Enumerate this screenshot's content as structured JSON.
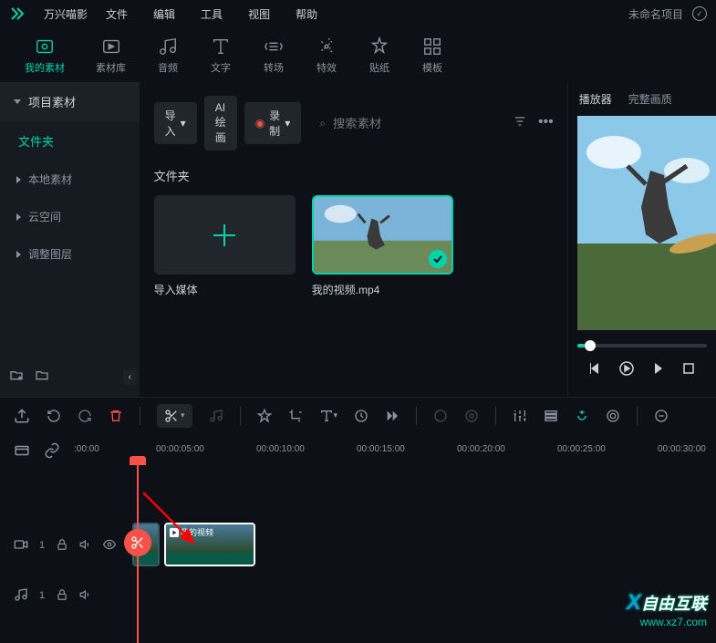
{
  "titlebar": {
    "app_name": "万兴喵影",
    "menus": [
      "文件",
      "编辑",
      "工具",
      "视图",
      "帮助"
    ],
    "project_name": "未命名项目"
  },
  "toolbar_tabs": [
    {
      "label": "我的素材"
    },
    {
      "label": "素材库"
    },
    {
      "label": "音频"
    },
    {
      "label": "文字"
    },
    {
      "label": "转场"
    },
    {
      "label": "特效"
    },
    {
      "label": "贴纸"
    },
    {
      "label": "模板"
    }
  ],
  "sidebar": {
    "header": "项目素材",
    "folder": "文件夹",
    "items": [
      "本地素材",
      "云空间",
      "调整图层"
    ]
  },
  "content": {
    "import_btn": "导入",
    "ai_btn": "AI绘画",
    "record_btn": "录制",
    "search_placeholder": "搜索素材",
    "folder_label": "文件夹",
    "import_media": "导入媒体",
    "video_name": "我的视频.mp4"
  },
  "preview": {
    "tabs": [
      "播放器",
      "完整画质"
    ]
  },
  "timeline": {
    "ruler": [
      ":00:00",
      "00:00:05:00",
      "00:00:10:00",
      "00:00:15:00",
      "00:00:20:00",
      "00:00:25:00",
      "00:00:30:00"
    ],
    "video_track": "1",
    "audio_track": "1",
    "clip_name": "我的视频"
  },
  "watermark": {
    "top": "自由互联",
    "bottom": "www.xz7.com"
  }
}
